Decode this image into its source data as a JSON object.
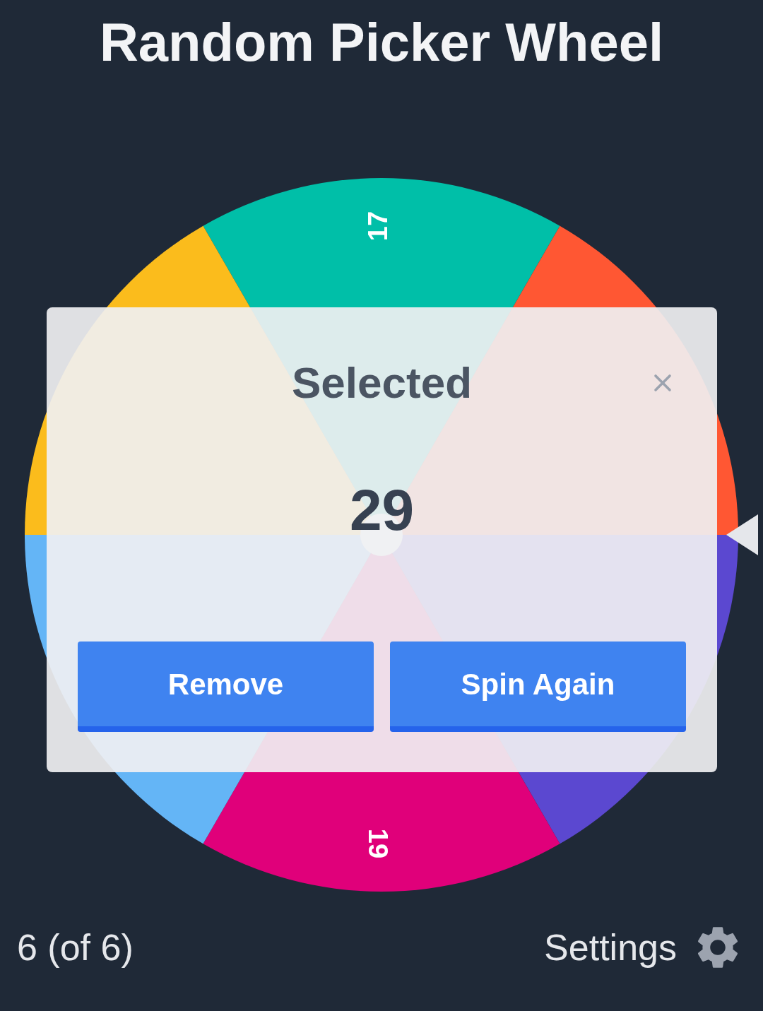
{
  "title": "Random Picker Wheel",
  "wheel": {
    "segments": [
      {
        "label": "17",
        "color": "#00bfa8"
      },
      {
        "color": "#ff5733"
      },
      {
        "color": "#5b48d0"
      },
      {
        "label": "19",
        "color": "#e0007a"
      },
      {
        "color": "#64b5f6"
      },
      {
        "color": "#fbbc1c"
      }
    ]
  },
  "dialog": {
    "title": "Selected",
    "value": "29",
    "buttons": [
      {
        "label": "Remove"
      },
      {
        "label": "Spin Again"
      }
    ]
  },
  "footer": {
    "count": "6 (of 6)",
    "settings": "Settings"
  }
}
